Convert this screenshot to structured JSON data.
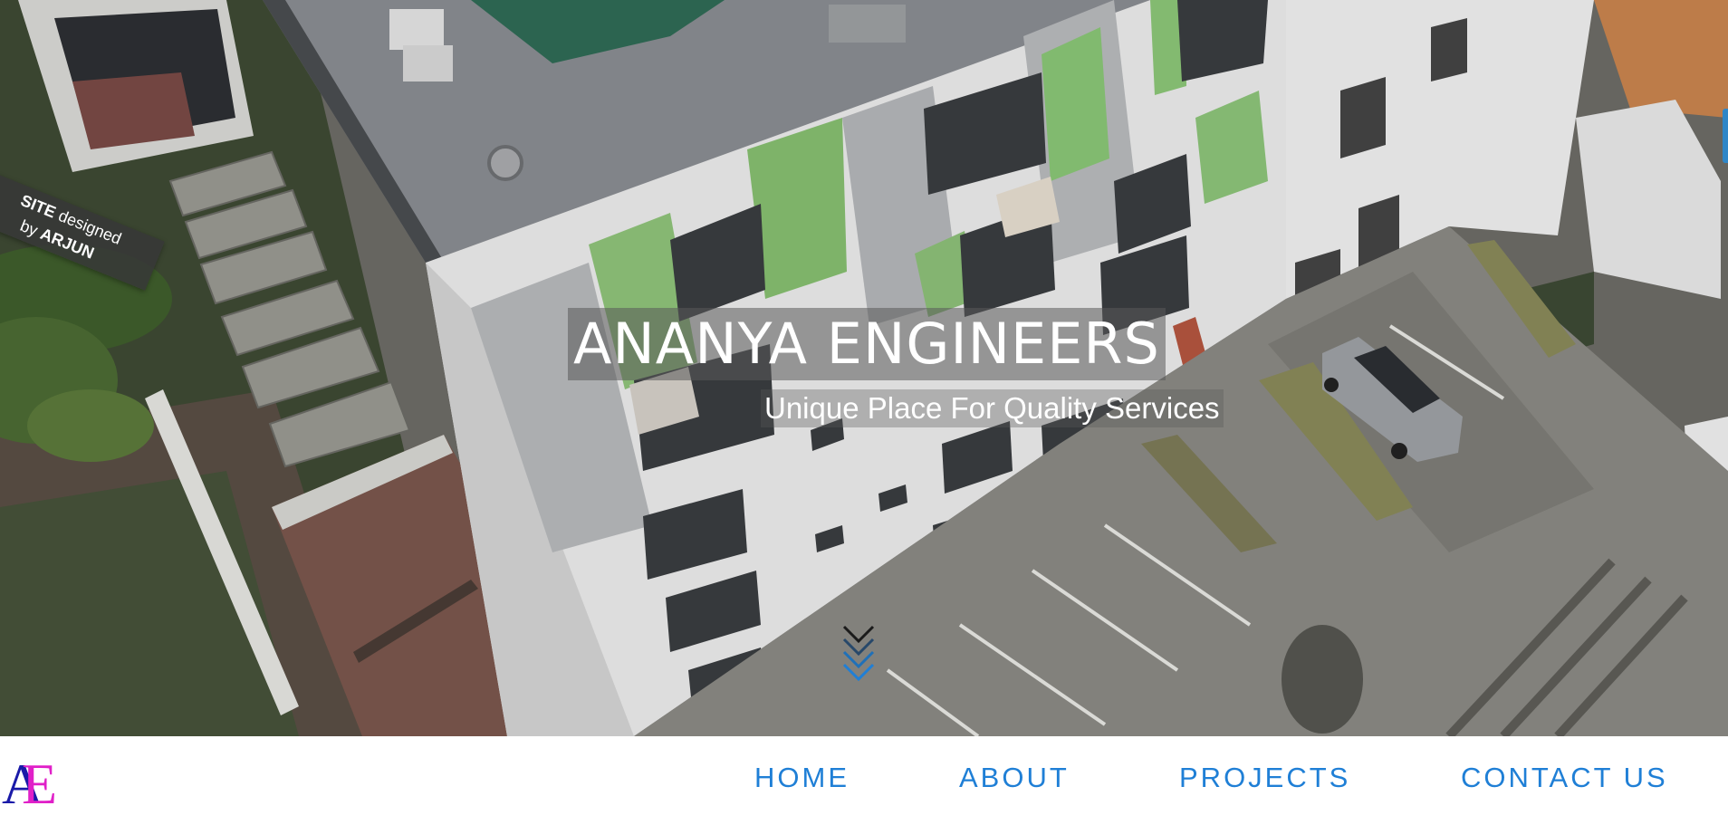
{
  "hero": {
    "title": "ANANYA ENGINEERS",
    "subtitle": "Unique Place For Quality Services",
    "scroll_icon": "chevrons-down-icon"
  },
  "credit": {
    "site_word": "SITE",
    "designed_word": "designed",
    "by_word": "by",
    "author": "ARJUN"
  },
  "logo": {
    "icon": "ae-monogram-logo",
    "colors": {
      "A": "#1a1aa8",
      "E": "#e020c8"
    }
  },
  "nav": {
    "items": [
      {
        "label": "HOME"
      },
      {
        "label": "ABOUT"
      },
      {
        "label": "PROJECTS"
      },
      {
        "label": "CONTACT US"
      }
    ],
    "color": "#1f7fd6"
  }
}
